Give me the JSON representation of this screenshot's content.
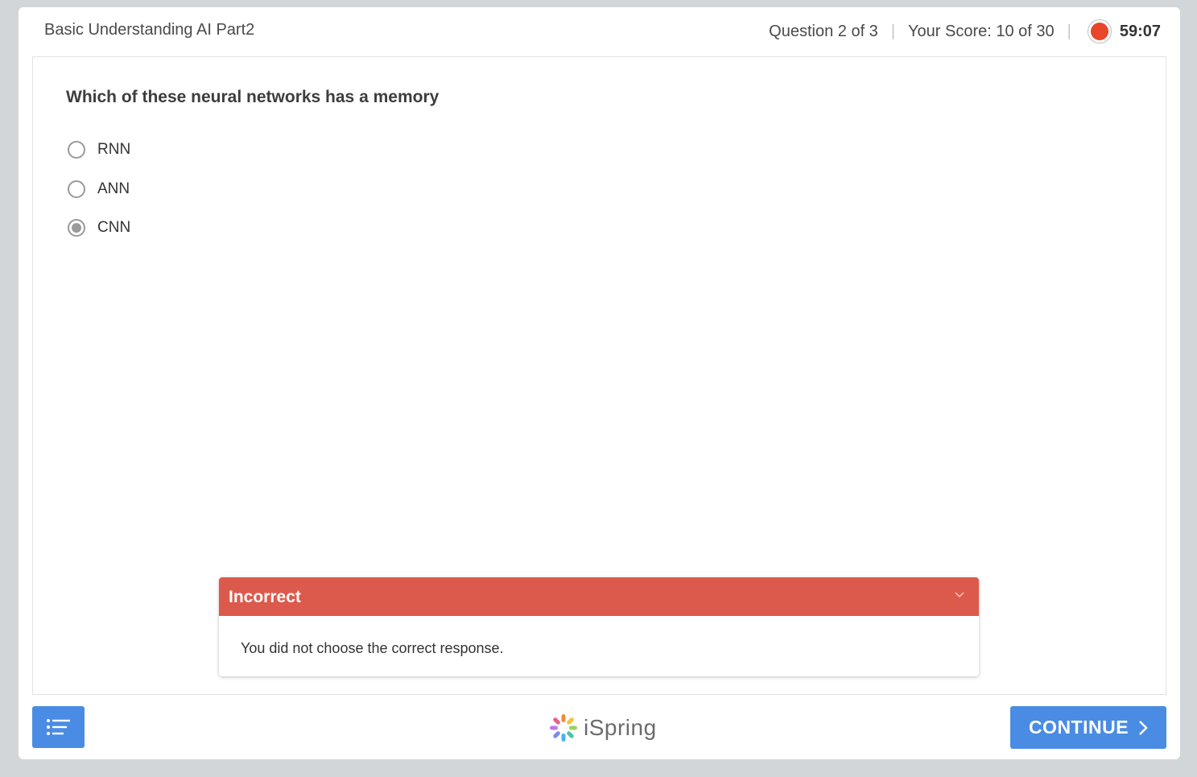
{
  "header": {
    "quiz_title": "Basic Understanding AI Part2",
    "question_progress": "Question 2 of 3",
    "separator": "|",
    "score": "Your Score: 10 of 30",
    "timer": "59:07"
  },
  "question": {
    "text": "Which of these neural networks has a memory",
    "options": [
      {
        "label": "RNN",
        "selected": false
      },
      {
        "label": "ANN",
        "selected": false
      },
      {
        "label": "CNN",
        "selected": true
      }
    ]
  },
  "feedback": {
    "title": "Incorrect",
    "message": "You did not choose the correct response.",
    "color": "#dc5a4c"
  },
  "footer": {
    "brand_name": "iSpring",
    "continue_label": "CONTINUE",
    "menu_icon": "list-icon"
  },
  "colors": {
    "accent": "#4a8ce4",
    "timer": "#e8472a",
    "background": "#d3d6d9"
  }
}
